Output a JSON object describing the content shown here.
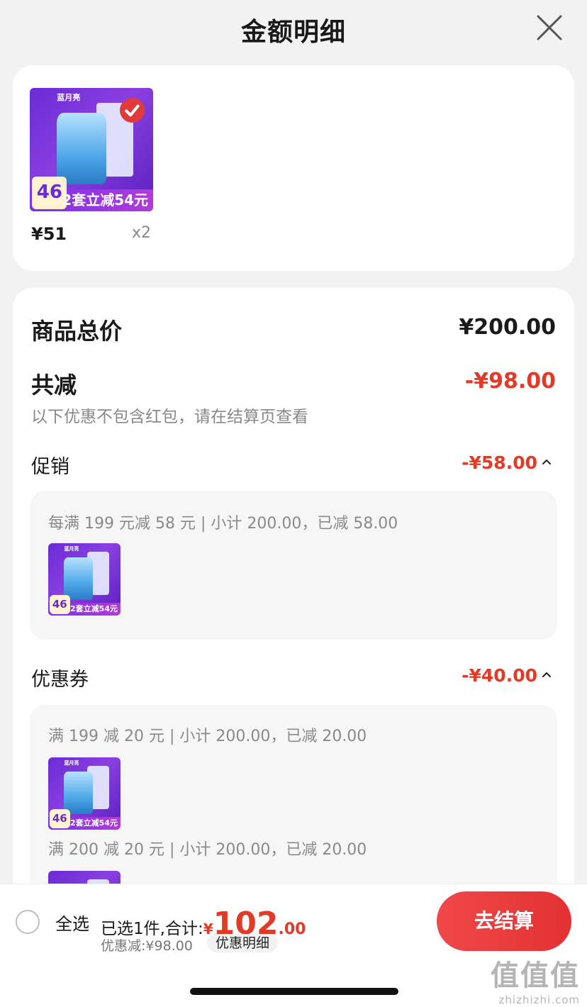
{
  "header": {
    "title": "金额明细"
  },
  "product": {
    "thumb": {
      "brand_text": "蓝月亮",
      "badge": "46",
      "promo_text": "2套立减54元"
    },
    "price": "¥51",
    "quantity": "x2"
  },
  "summary_card": {
    "total_label": "商品总价",
    "total_value": "¥200.00",
    "discount_label": "共减",
    "discount_value": "-¥98.00",
    "note": "以下优惠不包含红包，请在结算页查看",
    "promotion": {
      "label": "促销",
      "value": "-¥58.00",
      "detail": "每满 199 元减 58 元 | 小计 200.00，已减 58.00"
    },
    "coupon": {
      "label": "优惠券",
      "value": "-¥40.00",
      "details": [
        "满 199 减 20 元 | 小计 200.00，已减 20.00",
        "满 200 减 20 元 | 小计 200.00，已减 20.00"
      ]
    }
  },
  "bottom_bar": {
    "select_all": "全选",
    "selected_text": "已选1件,合计:",
    "currency": "¥",
    "total_int": "102",
    "total_dec": ".00",
    "discount_text": "优惠减:¥98.00",
    "detail_link": "优惠明细",
    "checkout": "去结算"
  },
  "watermark": {
    "glyphs": "值值值",
    "site": "zhizhizhi.com"
  },
  "colors": {
    "accent_red": "#e23a27",
    "button_red": "#ee3f3f",
    "thumb_purple": "#6a2bd6"
  },
  "icons": [
    "close-icon",
    "chevron-up-icon",
    "checkmark-icon",
    "radio-unchecked-icon"
  ]
}
